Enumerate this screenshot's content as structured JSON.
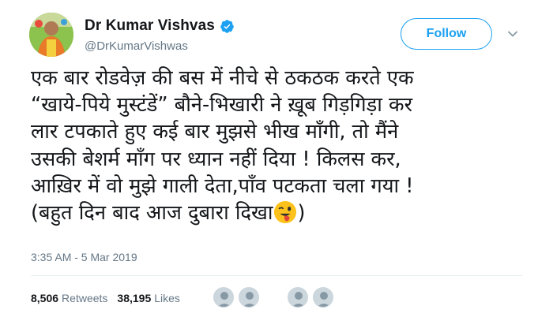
{
  "author": {
    "display_name": "Dr Kumar Vishvas",
    "handle": "@DrKumarVishwas",
    "verified": true
  },
  "follow_label": "Follow",
  "tweet": {
    "lines": [
      "एक बार रोडवेज़ की बस में नीचे से ठकठक करते एक",
      "“खाये-पिये मुस्टंडें” बौने-भिखारी ने ख़ूब गिड़गिड़ा कर",
      "लार टपकाते हुए कई बार मुझसे भीख माँगी, तो मैंने",
      "उसकी बेशर्म माँग पर ध्यान नहीं दिया ! किलस कर,",
      "आख़िर में वो मुझे गाली देता,पाँव पटकता चला गया !",
      "(बहुत दिन बाद आज दुबारा दिखा"
    ],
    "closing": ")",
    "emoji": "winking-face-with-tongue-emoji"
  },
  "timestamp": "3:35 AM - 5 Mar 2019",
  "stats": {
    "retweets_count": "8,506",
    "retweets_label": "Retweets",
    "likes_count": "38,195",
    "likes_label": "Likes"
  },
  "colors": {
    "accent": "#1da1f2",
    "secondary_text": "#657786",
    "primary_text": "#14171a"
  }
}
